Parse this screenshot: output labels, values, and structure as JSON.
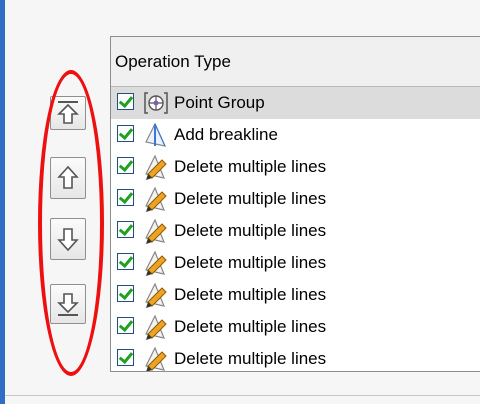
{
  "list": {
    "column_header": "Operation Type",
    "rows": [
      {
        "label": "Point Group",
        "checked": true,
        "icon": "point-group-icon"
      },
      {
        "label": "Add breakline",
        "checked": true,
        "icon": "add-breakline-icon"
      },
      {
        "label": "Delete multiple lines",
        "checked": true,
        "icon": "delete-lines-icon"
      },
      {
        "label": "Delete multiple lines",
        "checked": true,
        "icon": "delete-lines-icon"
      },
      {
        "label": "Delete multiple lines",
        "checked": true,
        "icon": "delete-lines-icon"
      },
      {
        "label": "Delete multiple lines",
        "checked": true,
        "icon": "delete-lines-icon"
      },
      {
        "label": "Delete multiple lines",
        "checked": true,
        "icon": "delete-lines-icon"
      },
      {
        "label": "Delete multiple lines",
        "checked": true,
        "icon": "delete-lines-icon"
      },
      {
        "label": "Delete multiple lines",
        "checked": true,
        "icon": "delete-lines-icon"
      }
    ]
  },
  "buttons": [
    {
      "icon": "move-to-top-icon"
    },
    {
      "icon": "move-up-icon"
    },
    {
      "icon": "move-down-icon"
    },
    {
      "icon": "move-to-bottom-icon"
    }
  ],
  "colors": {
    "annotation": "#ee1010",
    "checkmark": "#21a121",
    "window_edge": "#2f6ec4"
  }
}
